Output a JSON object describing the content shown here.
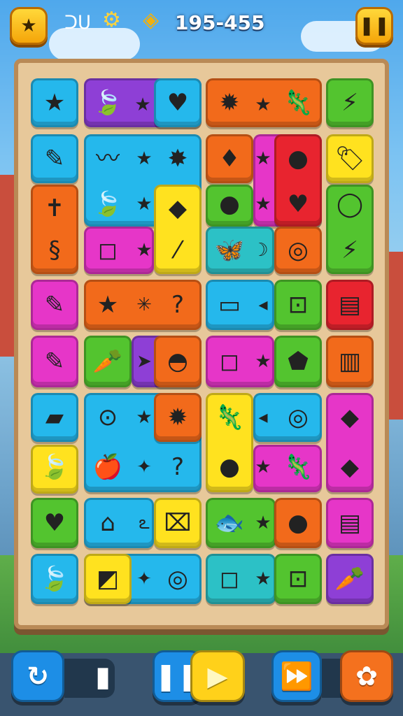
{
  "hud": {
    "score": "195-455",
    "star_icon": "★",
    "gear_icon": "⚙",
    "coin_icon": "◈",
    "loop_icon": "ᑐᑌ"
  },
  "board": {
    "colors": {
      "blue": "#25b8ec",
      "purple": "#8e3fd6",
      "orange": "#f26a1b",
      "green": "#53c42f",
      "red": "#e8242f",
      "pink": "#e636c8",
      "yellow": "#ffe21f",
      "teal": "#2cc1c6",
      "frame": "#e7c89a"
    },
    "icons": [
      "★",
      "🍃",
      "★",
      "♥",
      "✹",
      "★",
      "🦎",
      "⚡",
      "✎",
      "〰",
      "★",
      "✸",
      "♦",
      "★",
      "●",
      "🏷",
      "✝",
      "🍃",
      "★",
      "◆",
      "●",
      "★",
      "♥",
      "◯",
      "§",
      "◻",
      "★",
      "⁄",
      "🦋",
      "☽",
      "◎",
      "⚡",
      "✎",
      "★",
      "✳",
      "?",
      "▭",
      "◂",
      "⊡",
      "▤",
      "✎",
      "🥕",
      "➤",
      "◓",
      "◻",
      "★",
      "⬟",
      "▥",
      "▰",
      "⊙",
      "★",
      "✹",
      "🦎",
      "◂",
      "◎",
      "◆",
      "🍃",
      "🍎",
      "✦",
      "?",
      "●",
      "★",
      "🦎",
      "◆",
      "♥",
      "⌂",
      "ఽ",
      "⌧",
      "🐟",
      "★",
      "●",
      "▤",
      "🍃",
      "◩",
      "✦",
      "◎",
      "◻",
      "★",
      "⊡",
      "🥕"
    ]
  },
  "bottom": {
    "restart_icon": "↻",
    "pause_icon": "❚❚",
    "play_icon": "▶",
    "skip_icon": "⏩",
    "flower_icon": "✿",
    "slot_indicator": "▮"
  }
}
